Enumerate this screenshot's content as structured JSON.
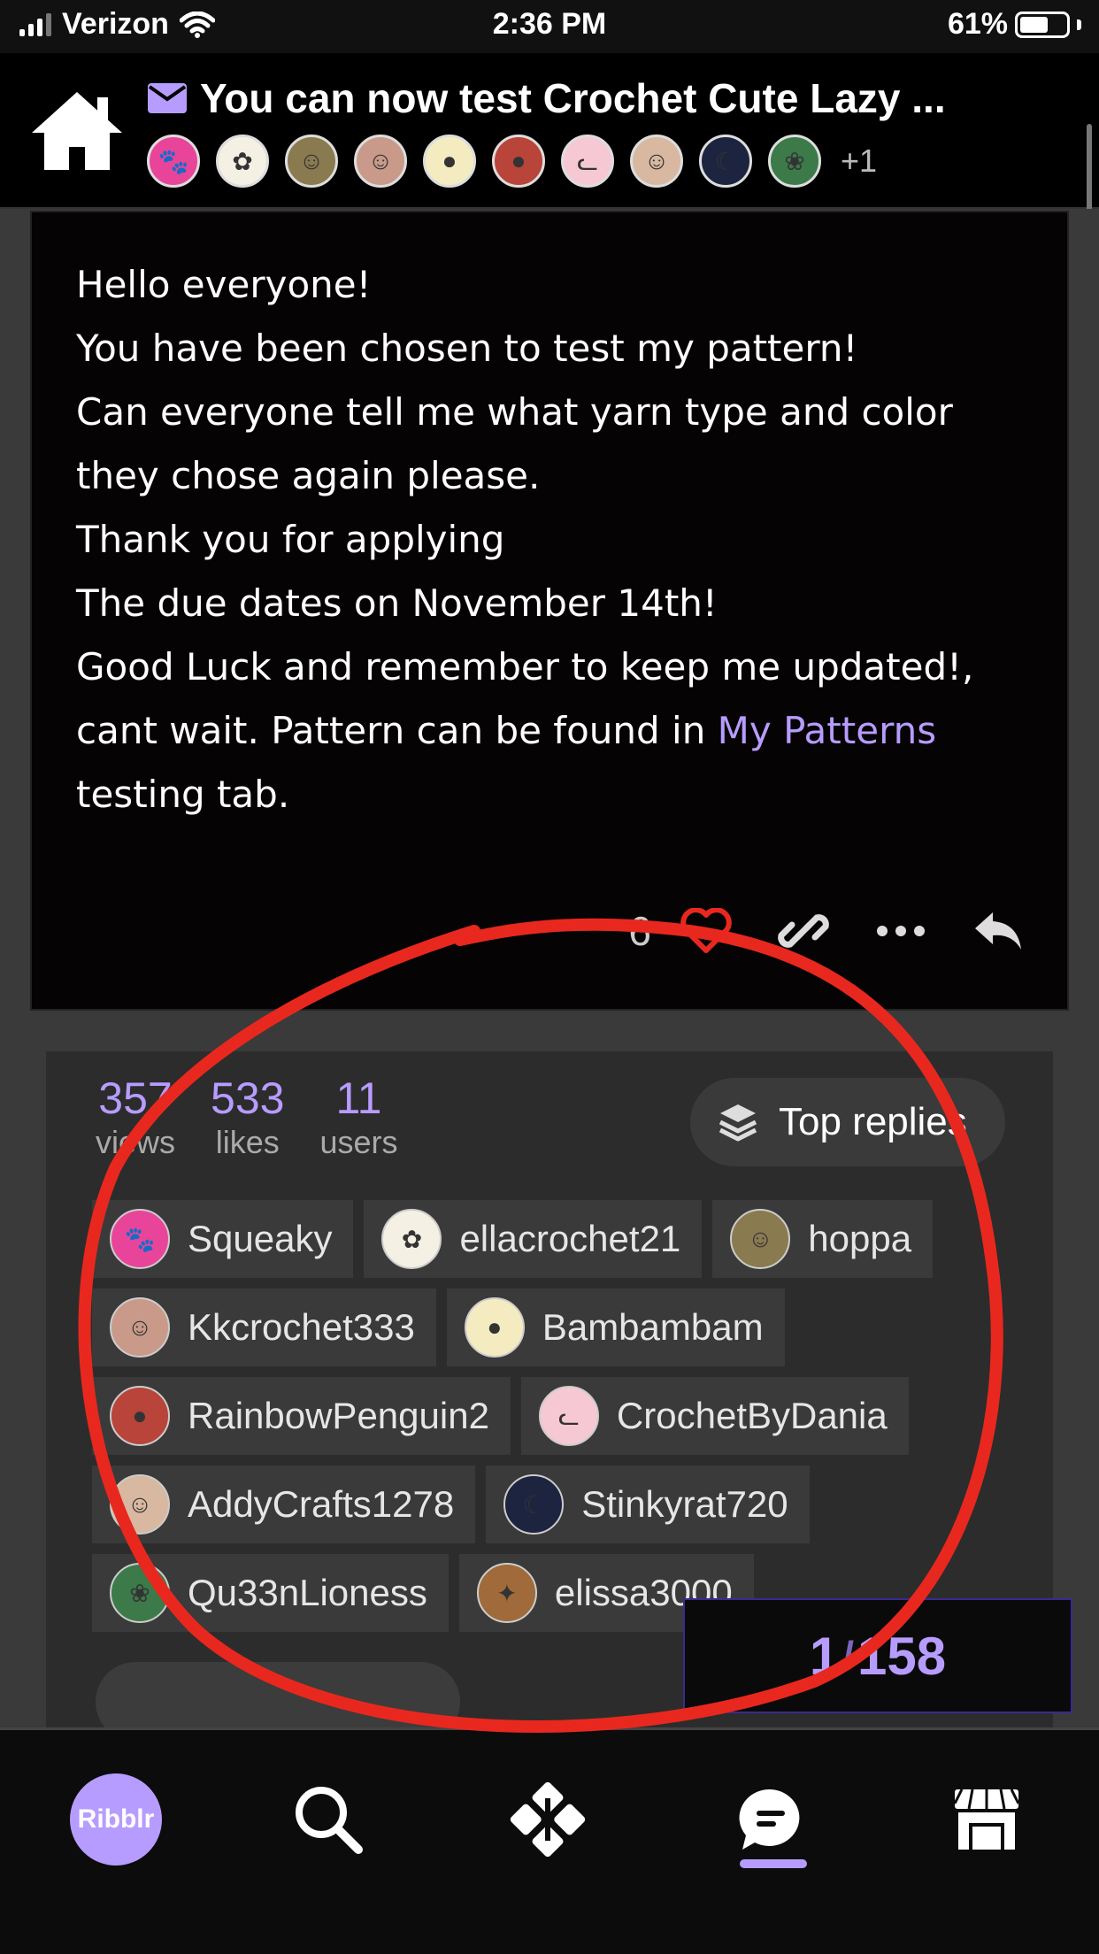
{
  "status_bar": {
    "carrier": "Verizon",
    "time": "2:36 PM",
    "battery": "61%",
    "battery_level": 0.61
  },
  "header": {
    "title": "You can now test Crochet Cute Lazy ...",
    "more_participants": "+1"
  },
  "post": {
    "lines": [
      "Hello everyone!",
      "You have been chosen to test my pattern!",
      "Can everyone tell me what yarn type and color",
      "they chose again please.",
      "Thank you for applying",
      "The due dates on November 14th!",
      "Good Luck and remember to keep me updated!,"
    ],
    "line_8_prefix": "cant wait. Pattern can be found in ",
    "link_text": "My Patterns",
    "line_9": "testing tab.",
    "like_count": "6"
  },
  "summary": {
    "views": "357",
    "views_label": "views",
    "likes": "533",
    "likes_label": "likes",
    "users": "11",
    "users_label": "users",
    "top_replies_label": "Top replies",
    "participants": [
      {
        "name": "Squeaky",
        "icon": "paw-icon",
        "color": "#e8459a"
      },
      {
        "name": "ellacrochet21",
        "icon": "flower-icon",
        "color": "#f4f0e4"
      },
      {
        "name": "hoppa",
        "icon": "person-icon",
        "color": "#8a7a50"
      },
      {
        "name": "Kkcrochet333",
        "icon": "person-icon",
        "color": "#c99a8a"
      },
      {
        "name": "Bambambam",
        "icon": "mushroom-icon",
        "color": "#f4ecc0"
      },
      {
        "name": "RainbowPenguin2",
        "icon": "penguin-icon",
        "color": "#b8443a"
      },
      {
        "name": "CrochetByDania",
        "icon": "cat-icon",
        "color": "#f6c8d4"
      },
      {
        "name": "AddyCrafts1278",
        "icon": "person-icon",
        "color": "#d8b8a0"
      },
      {
        "name": "Stinkyrat720",
        "icon": "moon-icon",
        "color": "#1c2440"
      },
      {
        "name": "Qu33nLioness",
        "icon": "wreath-icon",
        "color": "#3c7a4a"
      },
      {
        "name": "elissa3000",
        "icon": "bird-icon",
        "color": "#a06a3a"
      }
    ]
  },
  "progress": {
    "current": "1",
    "separator": "/",
    "total": "158"
  },
  "nav": {
    "logo_text": "Ribblr"
  },
  "colors": {
    "accent": "#b79cff",
    "annotation": "#e8281e",
    "page_bg": "#3a3a3a",
    "post_bg": "#060304"
  }
}
